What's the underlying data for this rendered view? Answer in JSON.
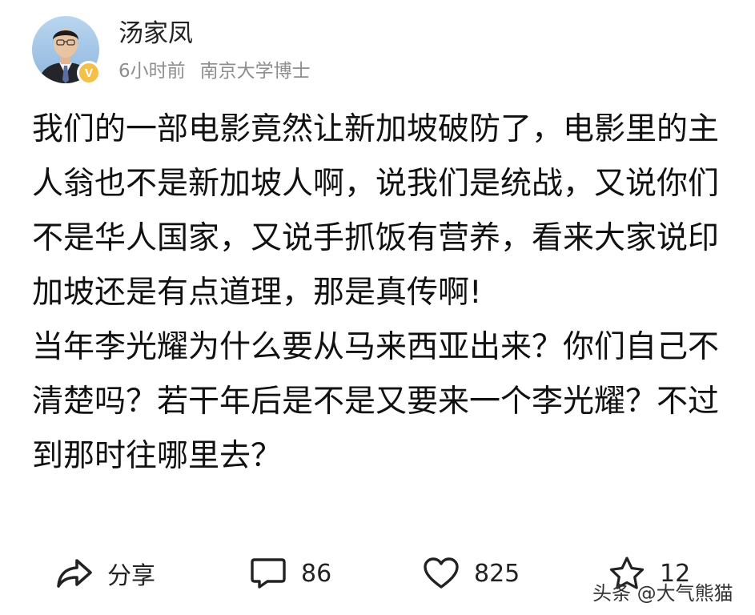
{
  "author": {
    "name": "汤家凤",
    "verified_badge": "V",
    "time_ago": "6小时前",
    "title": "南京大学博士"
  },
  "post": {
    "paragraphs": [
      "我们的一部电影竟然让新加坡破防了，电影里的主人翁也不是新加坡人啊，说我们是统战，又说你们不是华人国家，又说手抓饭有营养，看来大家说印加坡还是有点道理，那是真传啊!",
      "当年李光耀为什么要从马来西亚出来？你们自己不清楚吗？若干年后是不是又要来一个李光耀？不过到那时往哪里去？"
    ]
  },
  "actions": {
    "share": {
      "icon": "share-icon",
      "label": "分享"
    },
    "comment": {
      "icon": "comment-icon",
      "count": "86"
    },
    "like": {
      "icon": "heart-icon",
      "count": "825"
    },
    "favorite": {
      "icon": "star-icon",
      "count": "12"
    }
  },
  "watermark": "头条 @大气熊猫",
  "colors": {
    "badge": "#f3c04a",
    "meta_text": "#8e8e8e",
    "avatar_background": "#9fc3e6"
  }
}
